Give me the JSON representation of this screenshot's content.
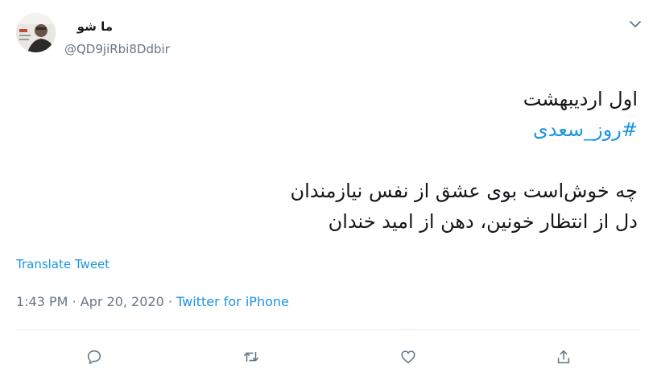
{
  "tweet": {
    "display_name": "ما شو",
    "handle": "@QD9jiRbi8Ddbir",
    "text_lines": [
      "اول اردیبهشت",
      "#روز_سعدی",
      "",
      "چه خوش‌است بوی عشق از نفس نیازمندان",
      "دل از انتظار خونین، دهن از امید خندان"
    ],
    "translate_label": "Translate Tweet",
    "time": "1:43 PM",
    "separator": "·",
    "date": "Apr 20, 2020",
    "source": "Twitter for iPhone"
  },
  "icons": {
    "more": "chevron-down-icon",
    "reply": "reply-icon",
    "retweet": "retweet-icon",
    "like": "like-icon",
    "share": "share-icon"
  },
  "colors": {
    "link": "#1b95e0",
    "secondary": "#657786",
    "primary_text": "#14171a",
    "divider": "#e6ecf0"
  }
}
